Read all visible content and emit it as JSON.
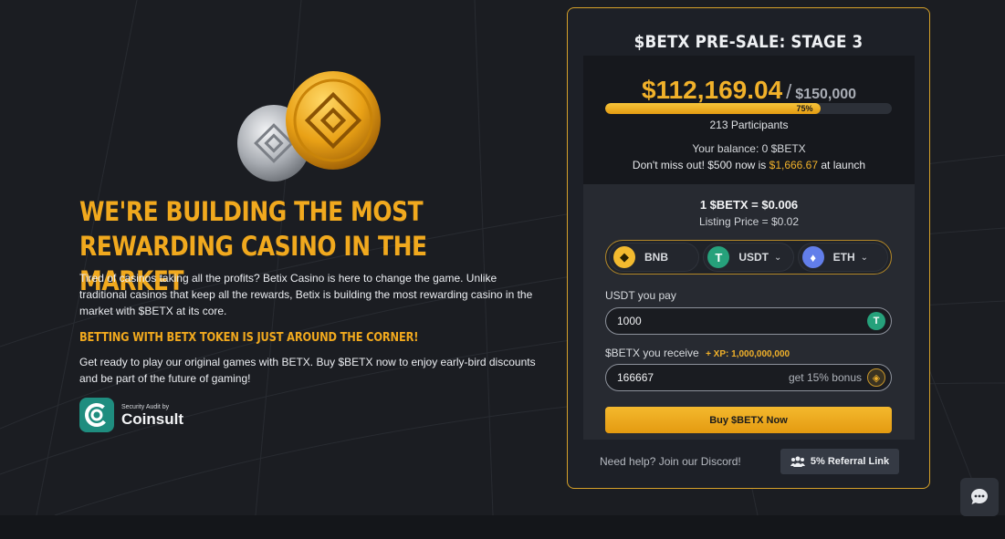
{
  "hero": {
    "headline": "WE'RE BUILDING THE MOST REWARDING CASINO IN THE MARKET",
    "paragraph1": "Tired of casinos taking all the profits? Betix Casino is here to change the game. Unlike traditional casinos that keep all the rewards, Betix is building the most rewarding casino in the market with $BETX at its core.",
    "subheading": "BETTING WITH BETX TOKEN IS JUST AROUND THE CORNER!",
    "paragraph2": "Get ready to play our original games with BETX. Buy $BETX now to enjoy early-bird discounts and be part of the future of gaming!",
    "audit_small": "Security Audit by",
    "audit_brand": "Coinsult"
  },
  "presale": {
    "title": "$BETX PRE-SALE: STAGE 3",
    "raised": "$112,169.04",
    "separator": "/",
    "goal": "$150,000",
    "progress_fraction": 0.75,
    "progress_label": "75%",
    "participants": "213 Participants",
    "balance": "Your balance: 0 $BETX",
    "dontmiss_prefix": "Don't miss out! $500 now is",
    "dontmiss_value": "$1,666.67",
    "dontmiss_suffix": "at launch"
  },
  "buy": {
    "rate": "1 $BETX = $0.006",
    "listing": "Listing Price = $0.02",
    "tokens": [
      {
        "label": "BNB",
        "icon": "bnb-icon",
        "color": "#f3ba2f"
      },
      {
        "label": "USDT",
        "icon": "usdt-icon",
        "color": "#26a17b"
      },
      {
        "label": "ETH",
        "icon": "eth-icon",
        "color": "#627eea"
      }
    ],
    "pay_label": "USDT you pay",
    "pay_value": "1000",
    "receive_label": "$BETX you receive",
    "xp_label": "+ XP: 1,000,000,000",
    "receive_value": "166667",
    "bonus": "get 15% bonus",
    "buy_button": "Buy $BETX Now",
    "help": "Need help? Join our Discord!",
    "referral": "5% Referral Link"
  },
  "colors": {
    "accent": "#f1a91e",
    "panel_border": "#d6a12a",
    "background": "#1b1d22"
  }
}
